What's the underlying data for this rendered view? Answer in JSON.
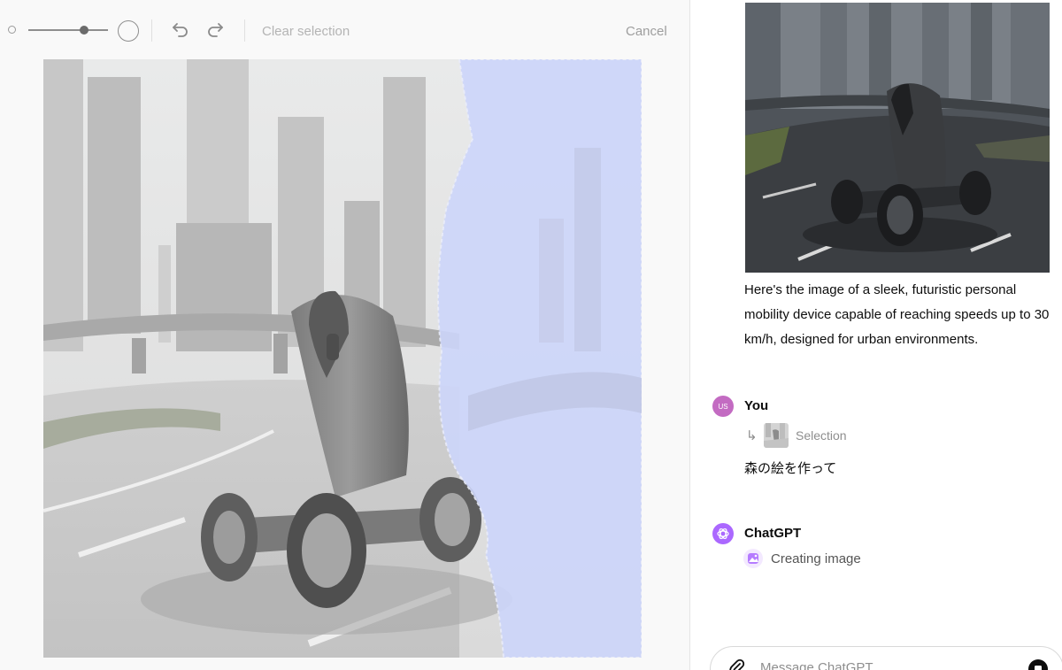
{
  "toolbar": {
    "clear_label": "Clear selection",
    "cancel_label": "Cancel",
    "icons": [
      "small-brush-icon",
      "brush-size-slider",
      "large-brush-icon",
      "undo-icon",
      "redo-icon"
    ]
  },
  "chat": {
    "assistant_reply": "Here's the image of a sleek, futuristic personal mobility device capable of reaching speeds up to 30 km/h, designed for urban environments.",
    "user": {
      "avatar_initials": "US",
      "name": "You",
      "selection_label": "Selection",
      "message": "森の絵を作って"
    },
    "assistant": {
      "name": "ChatGPT",
      "status": "Creating image"
    },
    "composer": {
      "placeholder": "Message ChatGPT"
    }
  },
  "colors": {
    "mask": "#cdd6fb",
    "user_avatar": "#c36bc2",
    "gpt_avatar": "#ab68ff"
  }
}
